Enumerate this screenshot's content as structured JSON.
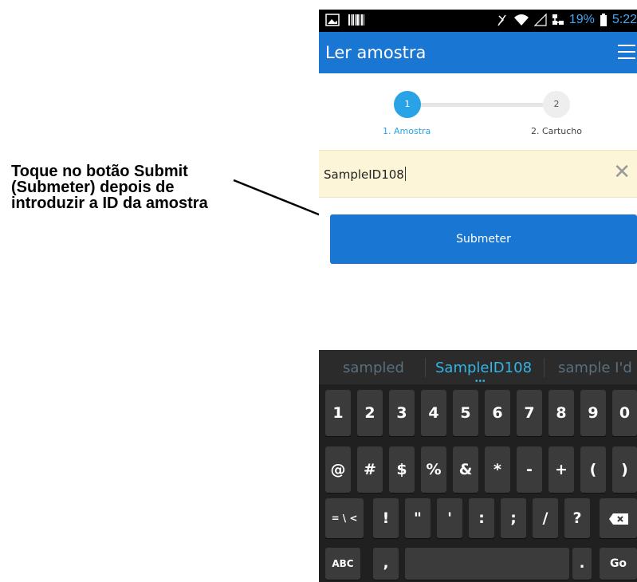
{
  "annotation": {
    "lines": [
      "Toque no botão Submit",
      "(Submeter) depois de",
      "introduzir a ID da amostra"
    ]
  },
  "status_bar": {
    "battery": "19%",
    "time": "5:22",
    "icons": [
      "image-icon",
      "barcode-icon",
      "mute-icon",
      "wifi-icon",
      "signal-icon",
      "network-icon",
      "battery-icon"
    ]
  },
  "app_bar": {
    "title": "Ler amostra",
    "menu_icon": "hamburger-menu-icon"
  },
  "stepper": {
    "steps": [
      {
        "number": "1",
        "label": "1. Amostra",
        "active": true
      },
      {
        "number": "2",
        "label": "2. Cartucho",
        "active": false
      }
    ]
  },
  "sample_input": {
    "value": "SampleID108",
    "clear_icon": "✕"
  },
  "submit_button": {
    "label": "Submeter"
  },
  "keyboard": {
    "suggestions": [
      "sampled",
      "SampleID108",
      "sample I'd"
    ],
    "row1": [
      "1",
      "2",
      "3",
      "4",
      "5",
      "6",
      "7",
      "8",
      "9",
      "0"
    ],
    "row2": [
      "@",
      "#",
      "$",
      "%",
      "&",
      "*",
      "-",
      "+",
      "(",
      ")"
    ],
    "row3": [
      "= \\ <",
      "!",
      "\"",
      "'",
      ":",
      ";",
      "/",
      "?"
    ],
    "row4": {
      "abc": "ABC",
      "comma": ",",
      "period": ".",
      "go": "Go"
    }
  },
  "colors": {
    "primary": "#1976d2",
    "step_active": "#29a3e6",
    "input_bg": "#fcf5d7",
    "suggest_active": "#33b5e5"
  }
}
